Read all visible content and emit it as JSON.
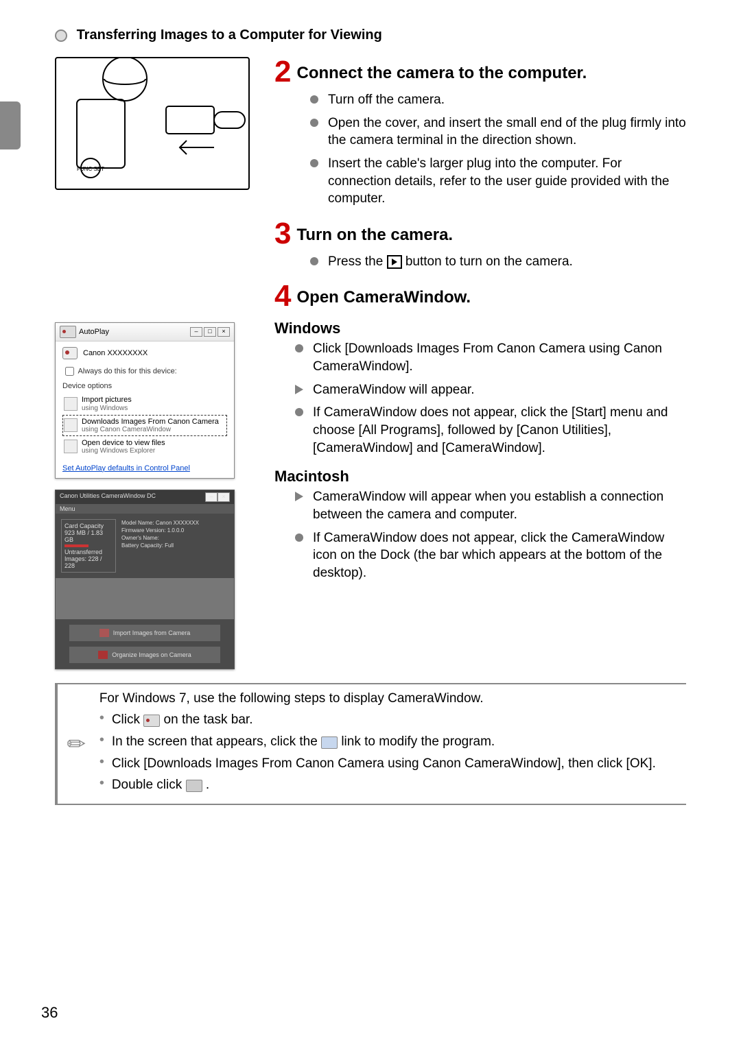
{
  "header": "Transferring Images to a Computer for Viewing",
  "step2": {
    "number": "2",
    "title": "Connect the camera to the computer.",
    "bullets": [
      "Turn off the camera.",
      "Open the cover, and insert the small end of the plug firmly into the camera terminal in the direction shown.",
      "Insert the cable's larger plug into the computer. For connection details, refer to the user guide provided with the computer."
    ]
  },
  "step3": {
    "number": "3",
    "title": "Turn on the camera.",
    "press_prefix": "Press the ",
    "press_suffix": " button to turn on the camera."
  },
  "step4": {
    "number": "4",
    "title": "Open CameraWindow."
  },
  "windows": {
    "heading": "Windows",
    "b1": "Click [Downloads Images From Canon Camera using Canon CameraWindow].",
    "b2": "CameraWindow will appear.",
    "b3": "If CameraWindow does not appear, click the [Start] menu and choose [All Programs], followed by [Canon Utilities], [CameraWindow] and [CameraWindow]."
  },
  "mac": {
    "heading": "Macintosh",
    "b1": "CameraWindow will appear when you establish a connection between the camera and computer.",
    "b2": "If CameraWindow does not appear, click the CameraWindow icon on the Dock (the bar which appears at the bottom of the desktop)."
  },
  "autoplay": {
    "title": "AutoPlay",
    "device": "Canon XXXXXXXX",
    "always": "Always do this for this device:",
    "options_label": "Device options",
    "opt1": {
      "title": "Import pictures",
      "sub": "using Windows"
    },
    "opt2": {
      "title": "Downloads Images From Canon Camera",
      "sub": "using Canon CameraWindow"
    },
    "opt3": {
      "title": "Open device to view files",
      "sub": "using Windows Explorer"
    },
    "link": "Set AutoPlay defaults in Control Panel"
  },
  "cw": {
    "title": "Canon Utilities CameraWindow DC",
    "menu": "Menu",
    "card_label": "Card Capacity",
    "card_cap": "923 MB / 1.83 GB",
    "untrans": "Untransferred Images: 228 / 228",
    "model_label": "Model Name:",
    "model": "Canon XXXXXXX",
    "fw_label": "Firmware Version:",
    "fw": "1.0.0.0",
    "owner_label": "Owner's Name:",
    "batt_label": "Battery Capacity:",
    "batt": "Full",
    "btn1": "Import Images from Camera",
    "btn2": "Organize Images on Camera"
  },
  "note": {
    "line0": "For Windows 7, use the following steps to display CameraWindow.",
    "line1a": "Click ",
    "line1b": " on the task bar.",
    "line2a": "In the screen that appears, click the ",
    "line2b": " link to modify the program.",
    "line3": "Click [Downloads Images From Canon Camera using Canon CameraWindow], then click [OK].",
    "line4a": "Double click ",
    "line4b": "."
  },
  "page_number": "36"
}
